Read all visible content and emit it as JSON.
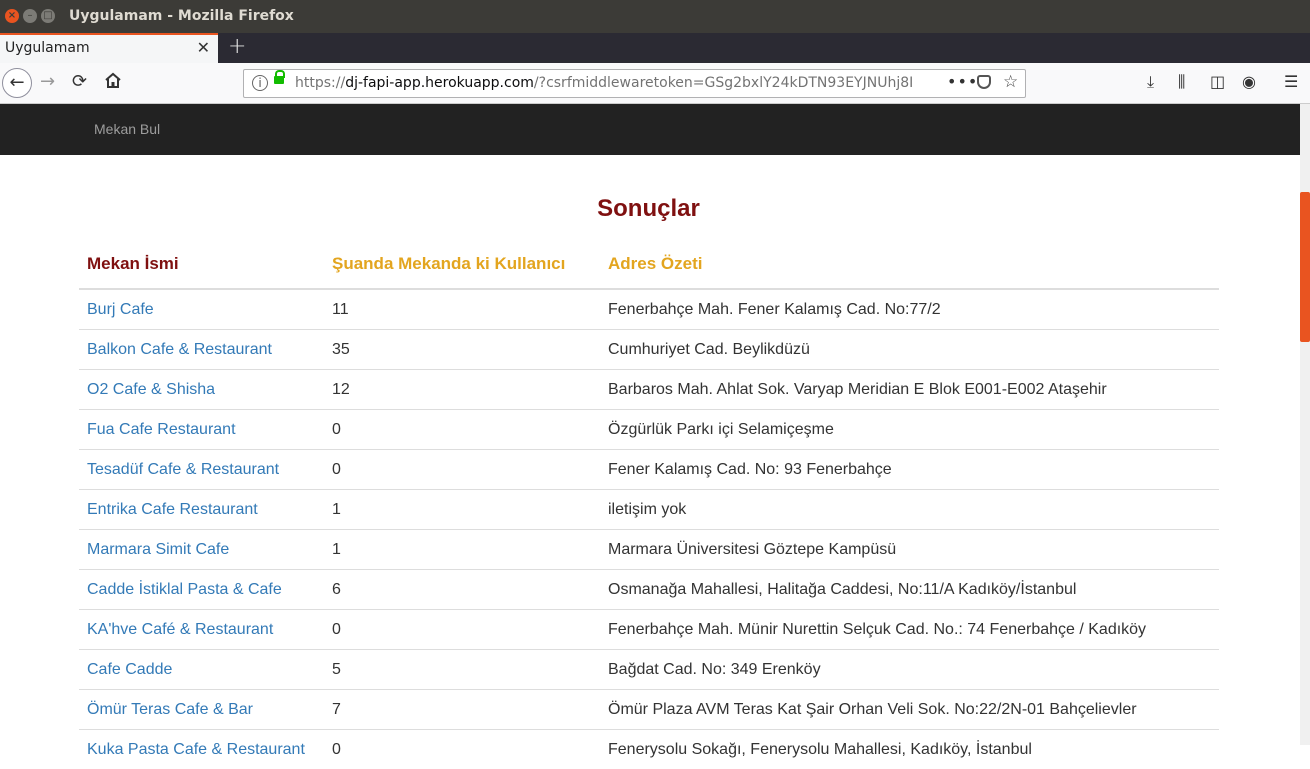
{
  "window": {
    "title": "Uygulamam - Mozilla Firefox"
  },
  "tab": {
    "label": "Uygulamam"
  },
  "urlbar": {
    "scheme": "https://",
    "host": "dj-fapi-app.herokuapp.com",
    "rest": "/?csrfmiddlewaretoken=GSg2bxlY24kDTN93EYJNUhj8I"
  },
  "site": {
    "brand": "Mekan Bul"
  },
  "page": {
    "heading": "Sonuçlar"
  },
  "table": {
    "headers": [
      "Mekan İsmi",
      "Şuanda Mekanda ki Kullanıcı",
      "Adres Özeti"
    ],
    "rows": [
      {
        "name": "Burj Cafe",
        "users": "11",
        "address": "Fenerbahçe Mah. Fener Kalamış Cad. No:77/2"
      },
      {
        "name": "Balkon Cafe & Restaurant",
        "users": "35",
        "address": "Cumhuriyet Cad. Beylikdüzü"
      },
      {
        "name": "O2 Cafe & Shisha",
        "users": "12",
        "address": "Barbaros Mah. Ahlat Sok. Varyap Meridian E Blok E001-E002 Ataşehir"
      },
      {
        "name": "Fua Cafe Restaurant",
        "users": "0",
        "address": "Özgürlük Parkı içi Selamiçeşme"
      },
      {
        "name": "Tesadüf Cafe & Restaurant",
        "users": "0",
        "address": "Fener Kalamış Cad. No: 93 Fenerbahçe"
      },
      {
        "name": "Entrika Cafe Restaurant",
        "users": "1",
        "address": "iletişim yok"
      },
      {
        "name": "Marmara Simit Cafe",
        "users": "1",
        "address": "Marmara Üniversitesi Göztepe Kampüsü"
      },
      {
        "name": "Cadde İstiklal Pasta & Cafe",
        "users": "6",
        "address": "Osmanağa Mahallesi, Halitağa Caddesi, No:11/A Kadıköy/İstanbul"
      },
      {
        "name": "KA'hve Café & Restaurant",
        "users": "0",
        "address": "Fenerbahçe Mah. Münir Nurettin Selçuk Cad. No.: 74 Fenerbahçe / Kadıköy"
      },
      {
        "name": "Cafe Cadde",
        "users": "5",
        "address": "Bağdat Cad. No: 349 Erenköy"
      },
      {
        "name": "Ömür Teras Cafe & Bar",
        "users": "7",
        "address": "Ömür Plaza AVM Teras Kat Şair Orhan Veli Sok. No:22/2N-01 Bahçelievler"
      },
      {
        "name": "Kuka Pasta Cafe & Restaurant",
        "users": "0",
        "address": "Fenerysolu Sokağı, Fenerysolu Mahallesi, Kadıköy, İstanbul"
      }
    ]
  }
}
